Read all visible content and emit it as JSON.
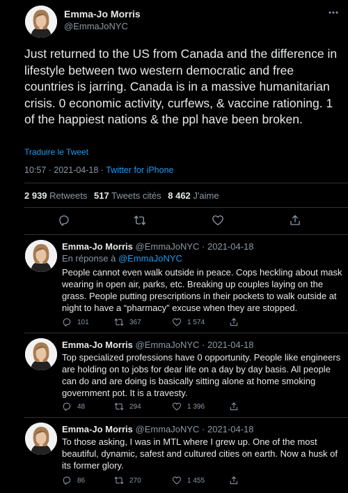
{
  "main": {
    "name": "Emma-Jo Morris",
    "handle": "@EmmaJoNYC",
    "text": "Just returned to the US from Canada and the difference in lifestyle between two western democratic and free countries is jarring. Canada is in a massive humanitarian crisis. 0 economic activity, curfews, & vaccine rationing. 1 of the happiest nations & the ppl have been broken.",
    "translate": "Traduire le Tweet",
    "time": "10:57 · 2021-04-18 · ",
    "source": "Twitter for iPhone",
    "stats": {
      "retweets_count": "2 939",
      "retweets_label": "Retweets",
      "quotes_count": "517",
      "quotes_label": "Tweets cités",
      "likes_count": "8 462",
      "likes_label": "J'aime"
    }
  },
  "replies": [
    {
      "name": "Emma-Jo Morris",
      "handle": "@EmmaJoNYC · 2021-04-18",
      "replying_prefix": "En réponse à ",
      "replying_to": "@EmmaJoNYC",
      "text": "People cannot even walk outside in peace. Cops heckling about mask wearing in open air, parks, etc. Breaking up couples laying on the grass. People putting prescriptions in their pockets to walk outside at night to have a “pharmacy” excuse when they are stopped.",
      "replies": "101",
      "retweets": "367",
      "likes": "1 574"
    },
    {
      "name": "Emma-Jo Morris",
      "handle": "@EmmaJoNYC · 2021-04-18",
      "text": "Top specialized professions have 0 opportunity. People like engineers are holding on to jobs for dear life on a day by day basis. All people can do and are doing is basically sitting alone at home smoking government pot. It is a travesty.",
      "replies": "48",
      "retweets": "294",
      "likes": "1 396"
    },
    {
      "name": "Emma-Jo Morris",
      "handle": "@EmmaJoNYC · 2021-04-18",
      "text": "To those asking, I was in MTL where I grew up. One of the most beautiful, dynamic, safest and cultured cities on earth. Now a husk of its former glory.",
      "replies": "86",
      "retweets": "270",
      "likes": "1 455"
    }
  ],
  "icons": {
    "reply": "reply-icon",
    "retweet": "retweet-icon",
    "like": "heart-icon",
    "share": "share-icon",
    "more": "more-icon"
  },
  "colors": {
    "accent": "#1d9bf0",
    "muted": "#8b98a5",
    "background": "#000000",
    "text": "#e7e9ea"
  }
}
